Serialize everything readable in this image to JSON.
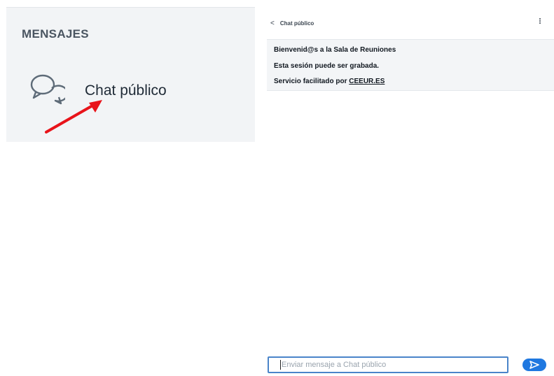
{
  "messages_panel": {
    "title": "MENSAJES",
    "chat_entry": {
      "label": "Chat público",
      "icon": "chat-bubbles-icon"
    }
  },
  "annotation": {
    "arrow_color": "#e8131a",
    "arrow_icon": "red-arrow-icon"
  },
  "chat": {
    "header": {
      "back_icon": "<",
      "title": "Chat público",
      "options_icon": "kebab-menu-icon"
    },
    "welcome": {
      "line1": "Bienvenid@s a la Sala de Reuniones",
      "line2": "Esta sesión puede ser grabada.",
      "line3_prefix": "Servicio facilitado por ",
      "line3_link": "CEEUR.ES"
    },
    "composer": {
      "placeholder": "Enviar mensaje a Chat público",
      "value": "",
      "send_icon": "send-icon"
    }
  },
  "colors": {
    "panel_background": "#f2f4f6",
    "accent": "#1f78e0",
    "input_border": "#4a84c9"
  }
}
